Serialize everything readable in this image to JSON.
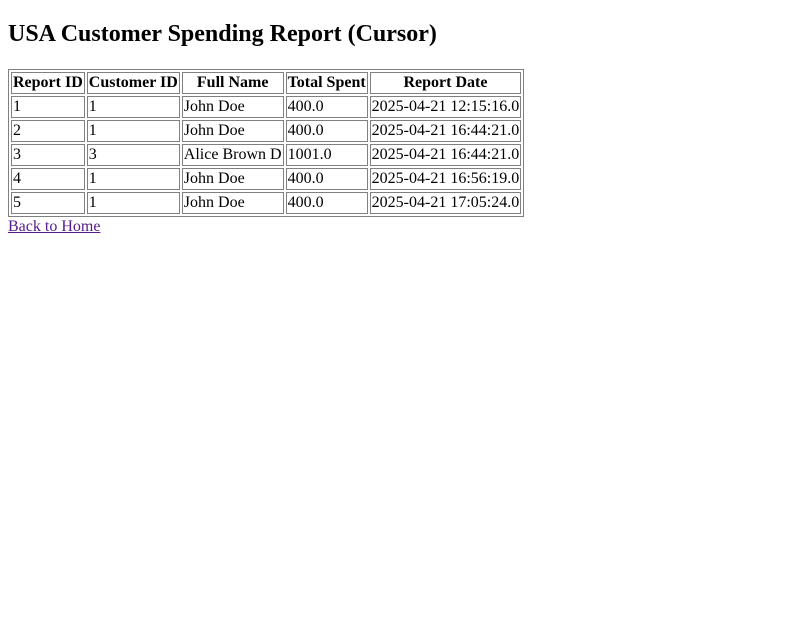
{
  "page": {
    "title": "USA Customer Spending Report (Cursor)"
  },
  "table": {
    "headers": [
      "Report ID",
      "Customer ID",
      "Full Name",
      "Total Spent",
      "Report Date"
    ],
    "rows": [
      [
        "1",
        "1",
        "John Doe",
        "400.0",
        "2025-04-21 12:15:16.0"
      ],
      [
        "2",
        "1",
        "John Doe",
        "400.0",
        "2025-04-21 16:44:21.0"
      ],
      [
        "3",
        "3",
        "Alice Brown D",
        "1001.0",
        "2025-04-21 16:44:21.0"
      ],
      [
        "4",
        "1",
        "John Doe",
        "400.0",
        "2025-04-21 16:56:19.0"
      ],
      [
        "5",
        "1",
        "John Doe",
        "400.0",
        "2025-04-21 17:05:24.0"
      ]
    ]
  },
  "links": {
    "back_home": "Back to Home"
  },
  "colors": {
    "link_visited": "#551a8b",
    "table_border": "#808080"
  }
}
